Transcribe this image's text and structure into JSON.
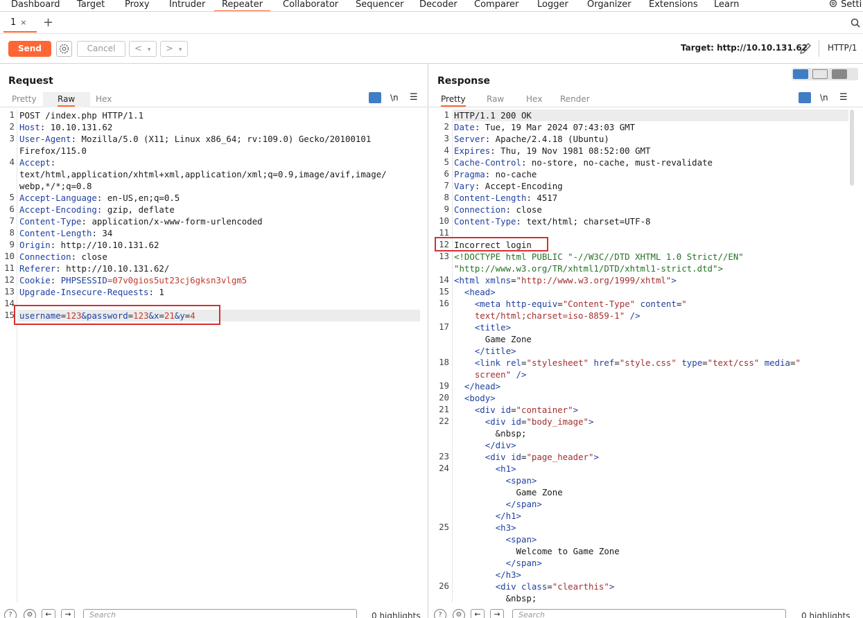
{
  "nav": {
    "tabs": [
      "Dashboard",
      "Target",
      "Proxy",
      "Intruder",
      "Repeater",
      "Collaborator",
      "Sequencer",
      "Decoder",
      "Comparer",
      "Logger",
      "Organizer",
      "Extensions",
      "Learn"
    ],
    "active": "Repeater",
    "settings_label": "Setti"
  },
  "subtabs": {
    "tab1": "1",
    "close": "×",
    "add": "+"
  },
  "toolbar": {
    "send": "Send",
    "cancel": "Cancel",
    "back": "<",
    "forward": ">",
    "dropdown": "▾",
    "target": "Target: http://10.10.131.62",
    "http_version": "HTTP/1"
  },
  "colors": {
    "accent": "#ff6633",
    "highlight_box": "#d62e2e",
    "header_key": "#1f3fa0",
    "param_value": "#c0392b"
  },
  "request": {
    "title": "Request",
    "tabs": [
      "Pretty",
      "Raw",
      "Hex"
    ],
    "active_tab": "Raw",
    "newline_toggle": "\\n",
    "menu": "☰",
    "lines": [
      {
        "n": "1",
        "k": "",
        "v": "POST /index.php HTTP/1.1"
      },
      {
        "n": "2",
        "k": "Host",
        "v": ": 10.10.131.62"
      },
      {
        "n": "3",
        "k": "User-Agent",
        "v": ": Mozilla/5.0 (X11; Linux x86_64; rv:109.0) Gecko/20100101"
      },
      {
        "n": "",
        "k": "",
        "v": "Firefox/115.0"
      },
      {
        "n": "4",
        "k": "Accept",
        "v": ":"
      },
      {
        "n": "",
        "k": "",
        "v": "text/html,application/xhtml+xml,application/xml;q=0.9,image/avif,image/"
      },
      {
        "n": "",
        "k": "",
        "v": "webp,*/*;q=0.8"
      },
      {
        "n": "5",
        "k": "Accept-Language",
        "v": ": en-US,en;q=0.5"
      },
      {
        "n": "6",
        "k": "Accept-Encoding",
        "v": ": gzip, deflate"
      },
      {
        "n": "7",
        "k": "Content-Type",
        "v": ": application/x-www-form-urlencoded"
      },
      {
        "n": "8",
        "k": "Content-Length",
        "v": ": 34"
      },
      {
        "n": "9",
        "k": "Origin",
        "v": ": http://10.10.131.62"
      },
      {
        "n": "10",
        "k": "Connection",
        "v": ": close"
      },
      {
        "n": "11",
        "k": "Referer",
        "v": ": http://10.10.131.62/"
      },
      {
        "n": "12",
        "k": "Cookie",
        "v": ": ",
        "ck": "PHPSESSID",
        "cv": "=07v0gios5ut23cj6gksn3vlgm5"
      },
      {
        "n": "13",
        "k": "Upgrade-Insecure-Requests",
        "v": ": 1"
      },
      {
        "n": "14",
        "k": "",
        "v": ""
      },
      {
        "n": "15",
        "body": [
          [
            "username",
            "=",
            "123"
          ],
          [
            "&password",
            "=",
            "123"
          ],
          [
            "&x",
            "=",
            "21"
          ],
          [
            "&y",
            "=",
            "4"
          ]
        ]
      }
    ]
  },
  "response": {
    "title": "Response",
    "tabs": [
      "Pretty",
      "Raw",
      "Hex",
      "Render"
    ],
    "active_tab": "Pretty",
    "newline_toggle": "\\n",
    "menu": "☰",
    "lines": [
      {
        "n": "1",
        "html": "HTTP/1.1 200 OK"
      },
      {
        "n": "2",
        "html": "<span class='hk'>Date</span>: Tue, 19 Mar 2024 07:43:03 GMT"
      },
      {
        "n": "3",
        "html": "<span class='hk'>Server</span>: Apache/2.4.18 (Ubuntu)"
      },
      {
        "n": "4",
        "html": "<span class='hk'>Expires</span>: Thu, 19 Nov 1981 08:52:00 GMT"
      },
      {
        "n": "5",
        "html": "<span class='hk'>Cache-Control</span>: no-store, no-cache, must-revalidate"
      },
      {
        "n": "6",
        "html": "<span class='hk'>Pragma</span>: no-cache"
      },
      {
        "n": "7",
        "html": "<span class='hk'>Vary</span>: Accept-Encoding"
      },
      {
        "n": "8",
        "html": "<span class='hk'>Content-Length</span>: 4517"
      },
      {
        "n": "9",
        "html": "<span class='hk'>Connection</span>: close"
      },
      {
        "n": "10",
        "html": "<span class='hk'>Content-Type</span>: text/html; charset=UTF-8"
      },
      {
        "n": "11",
        "html": ""
      },
      {
        "n": "12",
        "html": "Incorrect login"
      },
      {
        "n": "13",
        "html": "<span class='grn'>&lt;!DOCTYPE html PUBLIC \"-//W3C//DTD XHTML 1.0 Strict//EN\"</span>"
      },
      {
        "n": "",
        "html": "<span class='grn'>\"http://www.w3.org/TR/xhtml1/DTD/xhtml1-strict.dtd\"&gt;</span>"
      },
      {
        "n": "14",
        "html": "<span class='tag'>&lt;html</span> <span class='attr'>xmlns</span>=<span class='val'>\"http://www.w3.org/1999/xhtml\"</span><span class='tag'>&gt;</span>"
      },
      {
        "n": "15",
        "html": "  <span class='tag'>&lt;head&gt;</span>"
      },
      {
        "n": "16",
        "html": "    <span class='tag'>&lt;meta</span> <span class='attr'>http-equiv</span>=<span class='val'>\"Content-Type\"</span> <span class='attr'>content</span>=<span class='val'>\"</span>"
      },
      {
        "n": "",
        "html": "    <span class='val'>text/html;charset=iso-8859-1\"</span> <span class='tag'>/&gt;</span>"
      },
      {
        "n": "17",
        "html": "    <span class='tag'>&lt;title&gt;</span>"
      },
      {
        "n": "",
        "html": "      Game Zone"
      },
      {
        "n": "",
        "html": "    <span class='tag'>&lt;/title&gt;</span>"
      },
      {
        "n": "18",
        "html": "    <span class='tag'>&lt;link</span> <span class='attr'>rel</span>=<span class='val'>\"stylesheet\"</span> <span class='attr'>href</span>=<span class='val'>\"style.css\"</span> <span class='attr'>type</span>=<span class='val'>\"text/css\"</span> <span class='attr'>media</span>=<span class='val'>\"</span>"
      },
      {
        "n": "",
        "html": "    <span class='val'>screen\"</span> <span class='tag'>/&gt;</span>"
      },
      {
        "n": "19",
        "html": "  <span class='tag'>&lt;/head&gt;</span>"
      },
      {
        "n": "20",
        "html": "  <span class='tag'>&lt;body&gt;</span>"
      },
      {
        "n": "21",
        "html": "    <span class='tag'>&lt;div</span> <span class='attr'>id</span>=<span class='val'>\"container\"</span><span class='tag'>&gt;</span>"
      },
      {
        "n": "22",
        "html": "      <span class='tag'>&lt;div</span> <span class='attr'>id</span>=<span class='val'>\"body_image\"</span><span class='tag'>&gt;</span>"
      },
      {
        "n": "",
        "html": "        &amp;nbsp;"
      },
      {
        "n": "",
        "html": "      <span class='tag'>&lt;/div&gt;</span>"
      },
      {
        "n": "23",
        "html": "      <span class='tag'>&lt;div</span> <span class='attr'>id</span>=<span class='val'>\"page_header\"</span><span class='tag'>&gt;</span>"
      },
      {
        "n": "24",
        "html": "        <span class='tag'>&lt;h1&gt;</span>"
      },
      {
        "n": "",
        "html": "          <span class='tag'>&lt;span&gt;</span>"
      },
      {
        "n": "",
        "html": "            Game Zone"
      },
      {
        "n": "",
        "html": "          <span class='tag'>&lt;/span&gt;</span>"
      },
      {
        "n": "",
        "html": "        <span class='tag'>&lt;/h1&gt;</span>"
      },
      {
        "n": "25",
        "html": "        <span class='tag'>&lt;h3&gt;</span>"
      },
      {
        "n": "",
        "html": "          <span class='tag'>&lt;span&gt;</span>"
      },
      {
        "n": "",
        "html": "            Welcome to Game Zone"
      },
      {
        "n": "",
        "html": "          <span class='tag'>&lt;/span&gt;</span>"
      },
      {
        "n": "",
        "html": "        <span class='tag'>&lt;/h3&gt;</span>"
      },
      {
        "n": "26",
        "html": "        <span class='tag'>&lt;div</span> <span class='attr'>class</span>=<span class='val'>\"clearthis\"</span><span class='tag'>&gt;</span>"
      },
      {
        "n": "",
        "html": "          &amp;nbsp;"
      }
    ]
  },
  "bottom": {
    "search_placeholder": "Search",
    "highlights": "0 highlights",
    "help": "?",
    "back_arrow": "←",
    "fwd_arrow": "→"
  }
}
